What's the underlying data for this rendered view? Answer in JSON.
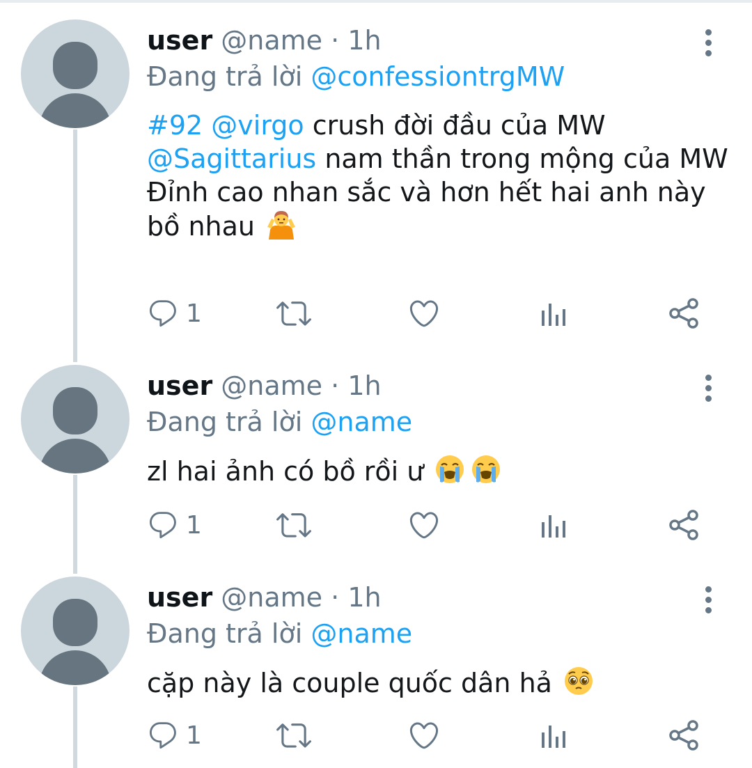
{
  "tweets": [
    {
      "username": "user",
      "handle": "@name",
      "time": "1h",
      "reply_prefix": "Đang trả lời",
      "reply_to": "@confessiontrgMW",
      "text": {
        "tag": "#92",
        "mention1": "@virgo",
        "part1": " crush đời đầu của MW",
        "mention2": "@Sagittarius",
        "part2": " nam thần trong mộng của MW",
        "part3": "Đỉnh cao nhan sắc và hơn hết hai anh này bồ nhau",
        "emoji": "person-shrugging-emoji"
      },
      "reply_count": "1"
    },
    {
      "username": "user",
      "handle": "@name",
      "time": "1h",
      "reply_prefix": "Đang trả lời",
      "reply_to": "@name",
      "text": {
        "part1": "zl hai ảnh có bồ rồi ư",
        "emoji": "loudly-crying-face-emoji"
      },
      "reply_count": "1"
    },
    {
      "username": "user",
      "handle": "@name",
      "time": "1h",
      "reply_prefix": "Đang trả lời",
      "reply_to": "@name",
      "text": {
        "part1": "cặp này là couple quốc dân hả",
        "emoji": "pleading-face-emoji"
      },
      "reply_count": "1"
    }
  ],
  "separator": "·",
  "icons": [
    "reply-icon",
    "retweet-icon",
    "like-icon",
    "analytics-icon",
    "share-icon",
    "more-icon"
  ],
  "colors": {
    "link": "#1da1f2",
    "secondary_text": "#657786",
    "primary_text": "#0f1419",
    "thread_line": "#cfd9de",
    "avatar_bg": "#ccd6dd",
    "avatar_fg": "#66757f"
  }
}
